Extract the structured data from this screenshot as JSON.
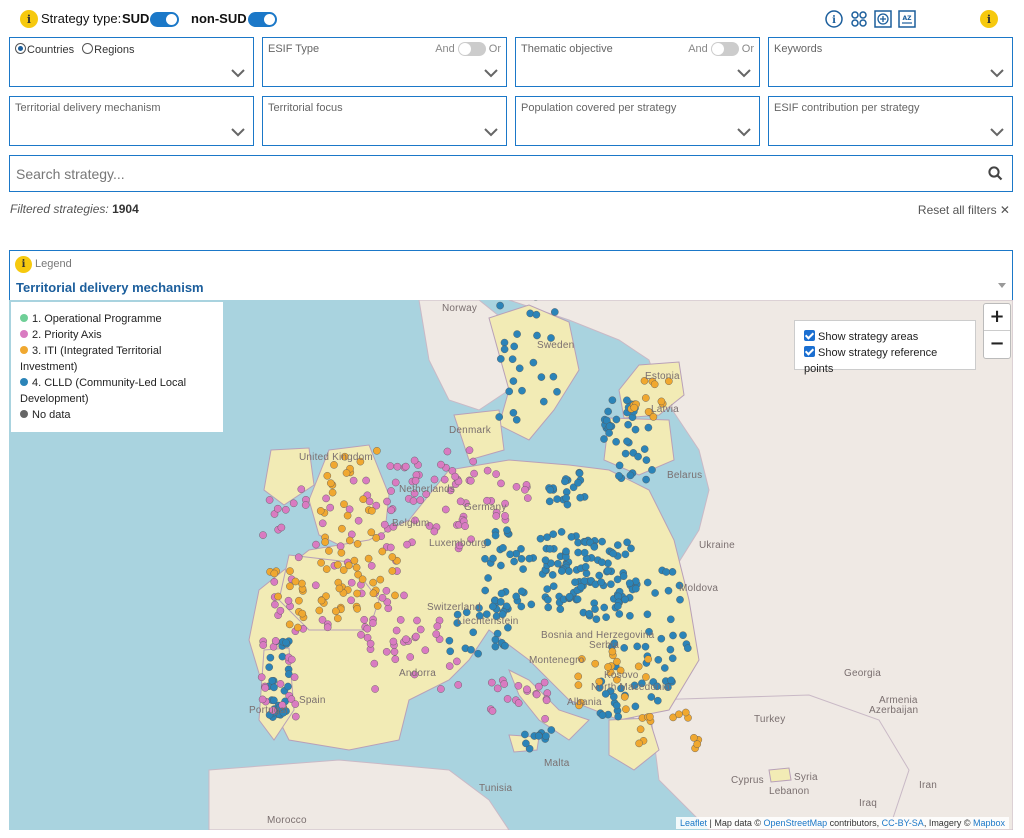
{
  "topbar": {
    "info_icon": "i",
    "strategy_type_label": "Strategy type:",
    "sud_label": "SUD",
    "non_sud_label": "non-SUD",
    "sud_on": true,
    "non_sud_on": true,
    "tools": [
      "info-icon",
      "network-icon",
      "add-icon",
      "az-sort-icon"
    ]
  },
  "filters": {
    "row1": [
      {
        "radio1": "Countries",
        "radio2": "Regions",
        "selected": "Countries"
      },
      {
        "label": "ESIF Type",
        "and": "And",
        "or": "Or"
      },
      {
        "label": "Thematic objective",
        "and": "And",
        "or": "Or"
      },
      {
        "label": "Keywords"
      }
    ],
    "row2": [
      {
        "label": "Territorial delivery mechanism"
      },
      {
        "label": "Territorial focus"
      },
      {
        "label": "Population covered per strategy"
      },
      {
        "label": "ESIF contribution per strategy"
      }
    ]
  },
  "search": {
    "placeholder": "Search strategy..."
  },
  "results": {
    "filtered_label": "Filtered strategies:",
    "filtered_count": "1904",
    "reset_label": "Reset all filters ✕"
  },
  "legend_select": {
    "label": "Legend",
    "value": "Territorial delivery mechanism"
  },
  "map": {
    "legend": [
      {
        "label": "1. Operational Programme",
        "color": "#6fcf97"
      },
      {
        "label": "2. Priority Axis",
        "color": "#d97bc1"
      },
      {
        "label": "3. ITI (Integrated Territorial Investment)",
        "color": "#f0a830"
      },
      {
        "label": "4. CLLD (Community-Led Local Development)",
        "color": "#2b84b8"
      },
      {
        "label": "No data",
        "color": "#666666"
      }
    ],
    "layers": {
      "areas": "Show strategy areas",
      "points": "Show strategy reference points"
    },
    "zoom_in": "+",
    "zoom_out": "−",
    "country_labels": [
      "Norway",
      "Sweden",
      "Estonia",
      "Latvia",
      "Denmark",
      "United Kingdom",
      "Netherlands",
      "Belarus",
      "Germany",
      "Belgium",
      "Luxembourg",
      "Ukraine",
      "Liechtenstein",
      "Switzerland",
      "Moldova",
      "Bosnia and Herzegovina",
      "Serbia",
      "Montenegro",
      "Kosovo",
      "North Macedonia",
      "Albania",
      "Andorra",
      "Spain",
      "Portugal",
      "Georgia",
      "Armenia",
      "Azerbaijan",
      "Turkey",
      "Malta",
      "Cyprus",
      "Syria",
      "Lebanon",
      "Tunisia",
      "Iraq",
      "Iran",
      "Morocco"
    ],
    "attribution": {
      "leaflet": "Leaflet",
      "text1": " | Map data © ",
      "osm": "OpenStreetMap",
      "text2": " contributors, ",
      "cc": "CC-BY-SA",
      "text3": ", Imagery © ",
      "mapbox": "Mapbox"
    }
  }
}
